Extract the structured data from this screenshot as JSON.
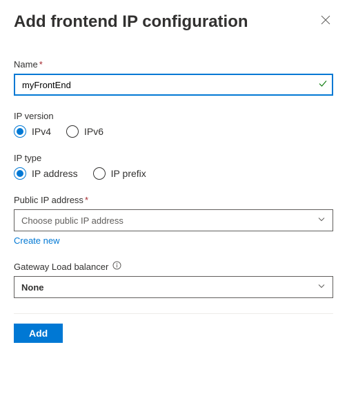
{
  "header": {
    "title": "Add frontend IP configuration"
  },
  "name": {
    "label": "Name",
    "value": "myFrontEnd",
    "required": "*"
  },
  "ip_version": {
    "label": "IP version",
    "options": {
      "ipv4": "IPv4",
      "ipv6": "IPv6"
    },
    "selected": "ipv4"
  },
  "ip_type": {
    "label": "IP type",
    "options": {
      "address": "IP address",
      "prefix": "IP prefix"
    },
    "selected": "address"
  },
  "public_ip": {
    "label": "Public IP address",
    "required": "*",
    "placeholder": "Choose public IP address",
    "create_new": "Create new"
  },
  "gateway": {
    "label": "Gateway Load balancer",
    "value": "None"
  },
  "footer": {
    "add": "Add"
  }
}
